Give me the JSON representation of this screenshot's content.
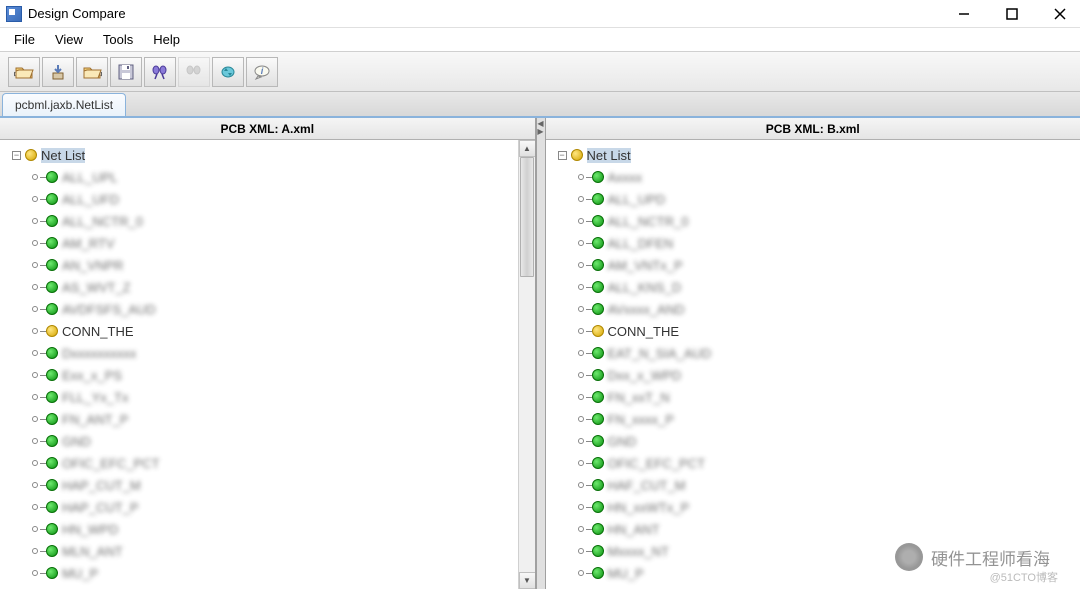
{
  "window": {
    "title": "Design Compare"
  },
  "menu": [
    "File",
    "View",
    "Tools",
    "Help"
  ],
  "tab": "pcbml.jaxb.NetList",
  "panes": {
    "left": {
      "header": "PCB XML: A.xml",
      "root": "Net List"
    },
    "right": {
      "header": "PCB XML: B.xml",
      "root": "Net List"
    }
  },
  "nets_left": [
    {
      "c": "green",
      "t": "ALL_UPL",
      "b": true
    },
    {
      "c": "green",
      "t": "ALL_UFD",
      "b": true
    },
    {
      "c": "green",
      "t": "ALL_NCTR_0",
      "b": true
    },
    {
      "c": "green",
      "t": "AM_RTV",
      "b": true
    },
    {
      "c": "green",
      "t": "AN_VNPR",
      "b": true
    },
    {
      "c": "green",
      "t": "AS_WVT_Z",
      "b": true
    },
    {
      "c": "green",
      "t": "AVDFSFS_AUD",
      "b": true
    },
    {
      "c": "yellow",
      "t": "CONN_THE",
      "b": false
    },
    {
      "c": "green",
      "t": "Dxxxxxxxxxx",
      "b": true
    },
    {
      "c": "green",
      "t": "Exx_x_PS",
      "b": true
    },
    {
      "c": "green",
      "t": "FLL_Yx_Tx",
      "b": true
    },
    {
      "c": "green",
      "t": "FN_ANT_P",
      "b": true
    },
    {
      "c": "green",
      "t": "GND",
      "b": true
    },
    {
      "c": "green",
      "t": "OFIC_EFC_PCT",
      "b": true
    },
    {
      "c": "green",
      "t": "HAP_CUT_M",
      "b": true
    },
    {
      "c": "green",
      "t": "HAP_CUT_P",
      "b": true
    },
    {
      "c": "green",
      "t": "HN_WPD",
      "b": true
    },
    {
      "c": "green",
      "t": "MLN_ANT",
      "b": true
    },
    {
      "c": "green",
      "t": "MU_P",
      "b": true
    }
  ],
  "nets_right": [
    {
      "c": "green",
      "t": "Axxxx",
      "b": true
    },
    {
      "c": "green",
      "t": "ALL_UPD",
      "b": true
    },
    {
      "c": "green",
      "t": "ALL_NCTR_0",
      "b": true
    },
    {
      "c": "green",
      "t": "ALL_DFEN",
      "b": true
    },
    {
      "c": "green",
      "t": "AM_VNTx_P",
      "b": true
    },
    {
      "c": "green",
      "t": "ALL_KNS_D",
      "b": true
    },
    {
      "c": "green",
      "t": "AVxxxx_AND",
      "b": true
    },
    {
      "c": "yellow",
      "t": "CONN_THE",
      "b": false
    },
    {
      "c": "green",
      "t": "EAT_N_SIA_AUD",
      "b": true
    },
    {
      "c": "green",
      "t": "Dxx_x_WPD",
      "b": true
    },
    {
      "c": "green",
      "t": "FN_xxT_N",
      "b": true
    },
    {
      "c": "green",
      "t": "FN_xxxx_P",
      "b": true
    },
    {
      "c": "green",
      "t": "GND",
      "b": true
    },
    {
      "c": "green",
      "t": "OFIC_EFC_PCT",
      "b": true
    },
    {
      "c": "green",
      "t": "HAF_CUT_M",
      "b": true
    },
    {
      "c": "green",
      "t": "HN_xxWTx_P",
      "b": true
    },
    {
      "c": "green",
      "t": "HN_ANT",
      "b": true
    },
    {
      "c": "green",
      "t": "Mxxxx_NT",
      "b": true
    },
    {
      "c": "green",
      "t": "MU_P",
      "b": true
    }
  ],
  "watermark": {
    "text": "硬件工程师看海",
    "sub": "@51CTO博客"
  }
}
